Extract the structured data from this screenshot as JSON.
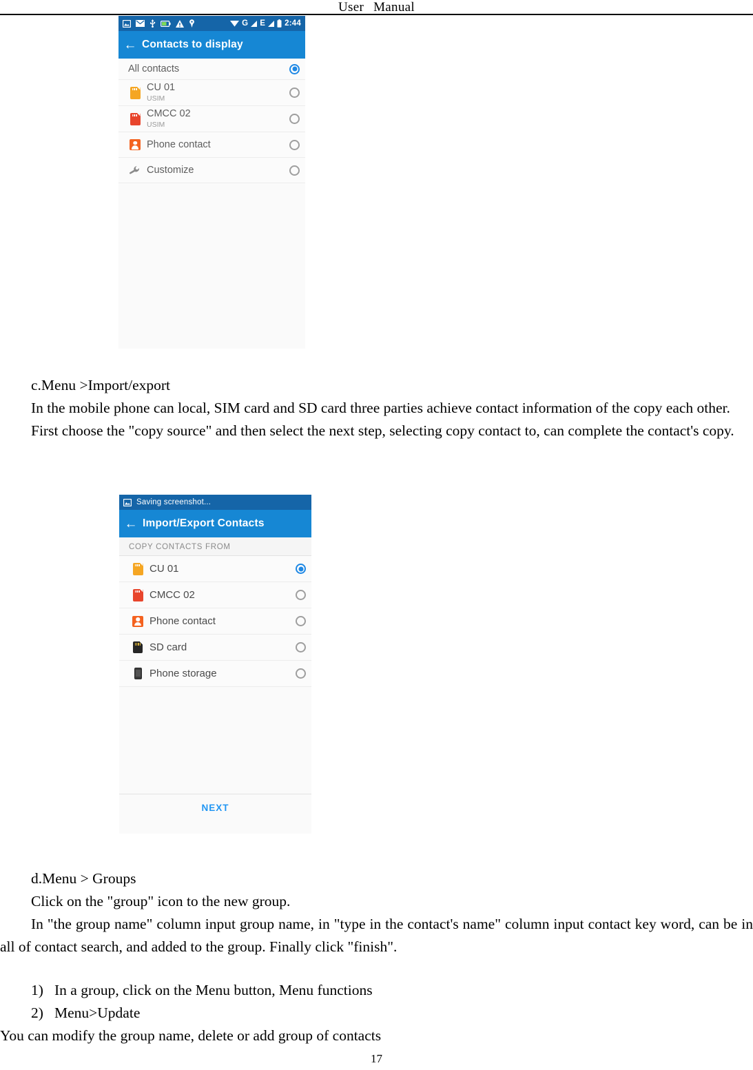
{
  "header": {
    "left_word": "User",
    "right_word": "Manual"
  },
  "page_number": "17",
  "colors": {
    "appbar_blue": "#1687d4",
    "statusbar_blue": "#1565a8",
    "radio_selected": "#1e88e5",
    "next_link": "#2196f3",
    "sim_orange": "#f5a623",
    "sim_red": "#e8452c",
    "person_orange": "#f4621f"
  },
  "screenshot_1": {
    "name": "contacts-to-display-screen",
    "statusbar": {
      "icons_left": [
        "screenshot-icon",
        "email-icon",
        "usb-icon",
        "battery-charging-icon",
        "warning-icon",
        "location-pin-icon"
      ],
      "icons_right": [
        "wifi-icon",
        "signal-g-icon",
        "signal-e-icon",
        "battery-icon"
      ],
      "network_g": "G",
      "network_e": "E",
      "time": "2:44"
    },
    "appbar": {
      "back_icon": "back-arrow-icon",
      "title": "Contacts to display"
    },
    "rows": [
      {
        "label": "All contacts",
        "sub": "",
        "icon": "none",
        "selected": true
      },
      {
        "label": "CU 01",
        "sub": "USIM",
        "icon": "sim-card-orange-icon",
        "selected": false
      },
      {
        "label": "CMCC 02",
        "sub": "USIM",
        "icon": "sim-card-red-icon",
        "selected": false
      },
      {
        "label": "Phone contact",
        "sub": "",
        "icon": "person-icon",
        "selected": false
      },
      {
        "label": "Customize",
        "sub": "",
        "icon": "wrench-icon",
        "selected": false
      }
    ]
  },
  "screenshot_2": {
    "name": "import-export-contacts-screen",
    "statusbar": {
      "icons_left": [
        "screenshot-icon"
      ],
      "text": "Saving screenshot..."
    },
    "appbar": {
      "back_icon": "back-arrow-icon",
      "title": "Import/Export Contacts"
    },
    "section_header": "COPY CONTACTS FROM",
    "rows": [
      {
        "label": "CU 01",
        "icon": "sim-card-orange-icon",
        "selected": true
      },
      {
        "label": "CMCC 02",
        "icon": "sim-card-red-icon",
        "selected": false
      },
      {
        "label": "Phone contact",
        "icon": "person-icon",
        "selected": false
      },
      {
        "label": "SD card",
        "icon": "sd-card-icon",
        "selected": false
      },
      {
        "label": "Phone storage",
        "icon": "phone-storage-icon",
        "selected": false
      }
    ],
    "next_label": "NEXT"
  },
  "body": {
    "block_c": {
      "heading": "c.Menu >Import/export",
      "para1": "In the mobile phone can local, SIM card and SD card three parties achieve contact information of the copy each other.",
      "para2": "First choose the \"copy source\" and then select the next step, selecting copy contact to, can complete the contact's copy."
    },
    "block_d": {
      "heading": "d.Menu > Groups",
      "para1": "Click on the \"group\" icon to the new group.",
      "para2": "In \"the group name\" column input group name, in \"type in the contact's name\" column input contact key word, can be in all of contact search, and added to the group. Finally click \"finish\"."
    },
    "numbered": [
      {
        "num": "1)",
        "text": "In a group, click on the Menu button,    Menu functions"
      },
      {
        "num": "2)",
        "text": "Menu>Update"
      }
    ],
    "closing": "You can modify the group name, delete or add group of contacts"
  }
}
